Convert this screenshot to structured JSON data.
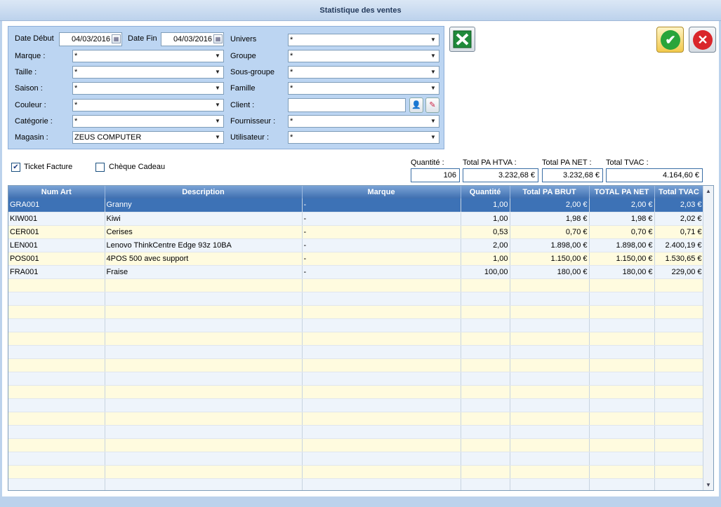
{
  "window": {
    "title": "Statistique des ventes"
  },
  "filters": {
    "date_debut_label": "Date Début",
    "date_debut": "04/03/2016",
    "date_fin_label": "Date Fin",
    "date_fin": "04/03/2016",
    "univers_label": "Univers",
    "univers": "*",
    "marque_label": "Marque :",
    "marque": "*",
    "groupe_label": "Groupe",
    "groupe": "*",
    "taille_label": "Taille :",
    "taille": "*",
    "sous_groupe_label": "Sous-groupe",
    "sous_groupe": "*",
    "saison_label": "Saison :",
    "saison": "*",
    "famille_label": "Famille",
    "famille": "*",
    "couleur_label": "Couleur :",
    "couleur": "*",
    "client_label": "Client :",
    "client": "",
    "categorie_label": "Catégorie :",
    "categorie": "*",
    "fournisseur_label": "Fournisseur :",
    "fournisseur": "*",
    "magasin_label": "Magasin :",
    "magasin": "ZEUS COMPUTER",
    "utilisateur_label": "Utilisateur :",
    "utilisateur": "*"
  },
  "options": {
    "ticket_facture_label": "Ticket Facture",
    "ticket_facture_checked": true,
    "cheque_cadeau_label": "Chèque Cadeau",
    "cheque_cadeau_checked": false
  },
  "totals": {
    "quantite_label": "Quantité :",
    "quantite": "106",
    "pa_htva_label": "Total PA HTVA :",
    "pa_htva": "3.232,68 €",
    "pa_net_label": "Total PA NET :",
    "pa_net": "3.232,68 €",
    "tvac_label": "Total TVAC :",
    "tvac": "4.164,60 €"
  },
  "grid": {
    "columns": [
      "Num Art",
      "Description",
      "Marque",
      "Quantité",
      "Total PA BRUT",
      "TOTAL PA NET",
      "Total TVAC"
    ],
    "rows": [
      [
        "GRA001",
        "Granny",
        "-",
        "1,00",
        "2,00 €",
        "2,00 €",
        "2,03 €"
      ],
      [
        "KIW001",
        "Kiwi",
        "-",
        "1,00",
        "1,98 €",
        "1,98 €",
        "2,02 €"
      ],
      [
        "CER001",
        "Cerises",
        "-",
        "0,53",
        "0,70 €",
        "0,70 €",
        "0,71 €"
      ],
      [
        "LEN001",
        "Lenovo ThinkCentre Edge 93z 10BA",
        "-",
        "2,00",
        "1.898,00 €",
        "1.898,00 €",
        "2.400,19 €"
      ],
      [
        "POS001",
        "4POS 500 avec support",
        "-",
        "1,00",
        "1.150,00 €",
        "1.150,00 €",
        "1.530,65 €"
      ],
      [
        "FRA001",
        "Fraise",
        "-",
        "100,00",
        "180,00 €",
        "180,00 €",
        "229,00 €"
      ]
    ],
    "selected_row": 0,
    "empty_rows": 16
  },
  "icons": {
    "excel": "excel-icon",
    "ok": "checkmark-icon",
    "cancel": "close-icon",
    "client_search": "person-icon",
    "client_clear": "eraser-icon",
    "calendar": "calendar-icon",
    "dropdown": "chevron-down-icon"
  },
  "colors": {
    "panel": "#bcd5f2",
    "header": "#3f6fb0",
    "selected": "#3d72b6",
    "row_even": "#fffbdf",
    "row_odd": "#eef4fb"
  }
}
